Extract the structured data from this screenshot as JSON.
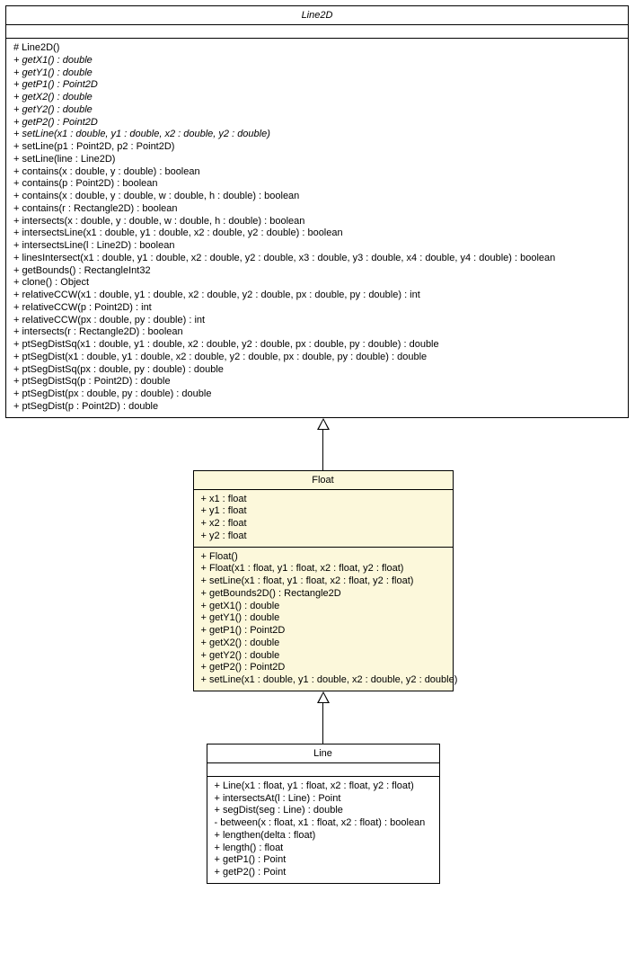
{
  "line2d": {
    "title": "Line2D",
    "methods": [
      {
        "text": "# Line2D()",
        "italic": false
      },
      {
        "text": "+ getX1() : double",
        "italic": true
      },
      {
        "text": "+ getY1() : double",
        "italic": true
      },
      {
        "text": "+ getP1() : Point2D",
        "italic": true
      },
      {
        "text": "+ getX2() : double",
        "italic": true
      },
      {
        "text": "+ getY2() : double",
        "italic": true
      },
      {
        "text": "+ getP2() : Point2D",
        "italic": true
      },
      {
        "text": "+ setLine(x1 : double, y1 : double, x2 : double, y2 : double)",
        "italic": true
      },
      {
        "text": "+ setLine(p1 : Point2D, p2 : Point2D)",
        "italic": false
      },
      {
        "text": "+ setLine(line : Line2D)",
        "italic": false
      },
      {
        "text": "+ contains(x : double, y : double) : boolean",
        "italic": false
      },
      {
        "text": "+ contains(p : Point2D) : boolean",
        "italic": false
      },
      {
        "text": "+ contains(x : double, y : double, w : double, h : double) : boolean",
        "italic": false
      },
      {
        "text": "+ contains(r : Rectangle2D) : boolean",
        "italic": false
      },
      {
        "text": "+ intersects(x : double, y : double, w : double, h : double) : boolean",
        "italic": false
      },
      {
        "text": "+ intersectsLine(x1 : double, y1 : double, x2 : double, y2 : double) : boolean",
        "italic": false
      },
      {
        "text": "+ intersectsLine(l : Line2D) : boolean",
        "italic": false
      },
      {
        "text": "+ linesIntersect(x1 : double, y1 : double, x2 : double, y2 : double, x3 : double, y3 : double, x4 : double, y4 : double) : boolean",
        "italic": false
      },
      {
        "text": "+ getBounds() : RectangleInt32",
        "italic": false
      },
      {
        "text": "+ clone() : Object",
        "italic": false
      },
      {
        "text": "+ relativeCCW(x1 : double, y1 : double, x2 : double, y2 : double, px : double, py : double) : int",
        "italic": false
      },
      {
        "text": "+ relativeCCW(p : Point2D) : int",
        "italic": false
      },
      {
        "text": "+ relativeCCW(px : double, py : double) : int",
        "italic": false
      },
      {
        "text": "+ intersects(r : Rectangle2D) : boolean",
        "italic": false
      },
      {
        "text": "+ ptSegDistSq(x1 : double, y1 : double, x2 : double, y2 : double, px : double, py : double) : double",
        "italic": false
      },
      {
        "text": "+ ptSegDist(x1 : double, y1 : double, x2 : double, y2 : double, px : double, py : double) : double",
        "italic": false
      },
      {
        "text": "+ ptSegDistSq(px : double, py : double) : double",
        "italic": false
      },
      {
        "text": "+ ptSegDistSq(p : Point2D) : double",
        "italic": false
      },
      {
        "text": "+ ptSegDist(px : double, py : double) : double",
        "italic": false
      },
      {
        "text": "+ ptSegDist(p : Point2D) : double",
        "italic": false
      }
    ]
  },
  "float": {
    "title": "Float",
    "fields": [
      {
        "text": "+ x1 : float"
      },
      {
        "text": "+ y1 : float"
      },
      {
        "text": "+ x2 : float"
      },
      {
        "text": "+ y2 : float"
      }
    ],
    "methods": [
      {
        "text": "+ Float()"
      },
      {
        "text": "+ Float(x1 : float, y1 : float, x2 : float, y2 : float)"
      },
      {
        "text": "+ setLine(x1 : float, y1 : float, x2 : float, y2 : float)"
      },
      {
        "text": "+ getBounds2D() : Rectangle2D"
      },
      {
        "text": "+ getX1() : double"
      },
      {
        "text": "+ getY1() : double"
      },
      {
        "text": "+ getP1() : Point2D"
      },
      {
        "text": "+ getX2() : double"
      },
      {
        "text": "+ getY2() : double"
      },
      {
        "text": "+ getP2() : Point2D"
      },
      {
        "text": "+ setLine(x1 : double, y1 : double, x2 : double, y2 : double)"
      }
    ]
  },
  "line": {
    "title": "Line",
    "methods": [
      {
        "text": "+ Line(x1 : float, y1 : float, x2 : float, y2 : float)"
      },
      {
        "text": "+ intersectsAt(l : Line) : Point"
      },
      {
        "text": "+ segDist(seg : Line) : double"
      },
      {
        "text": "- between(x : float, x1 : float, x2 : float) : boolean"
      },
      {
        "text": "+ lengthen(delta : float)"
      },
      {
        "text": "+ length() : float"
      },
      {
        "text": "+ getP1() : Point"
      },
      {
        "text": "+ getP2() : Point"
      }
    ]
  }
}
